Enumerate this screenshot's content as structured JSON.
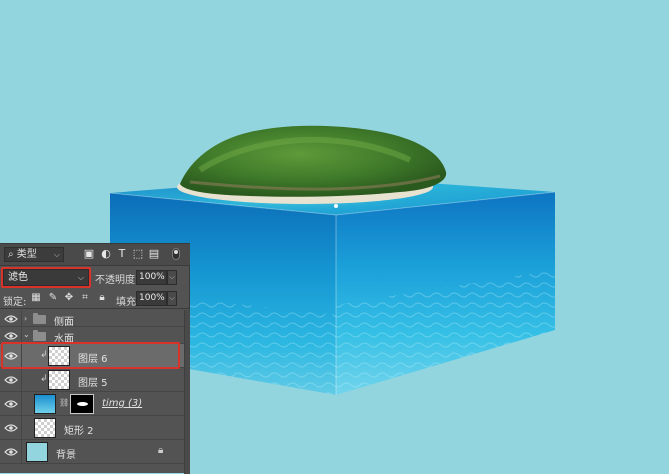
{
  "layers_panel": {
    "filter": {
      "kind_label": "类型"
    },
    "blend_mode": "滤色",
    "opacity_label": "不透明度:",
    "opacity_value": "100%",
    "lock_label": "锁定:",
    "fill_label": "填充:",
    "fill_value": "100%",
    "layers": [
      {
        "name": "侧面",
        "type": "group",
        "collapsed": true,
        "visible": true
      },
      {
        "name": "水面",
        "type": "group",
        "collapsed": false,
        "visible": true
      },
      {
        "name": "图层 6",
        "type": "layer",
        "clipped": true,
        "visible": true,
        "selected": true
      },
      {
        "name": "图层 5",
        "type": "layer",
        "clipped": true,
        "visible": true
      },
      {
        "name": "timg (3)",
        "type": "masked-layer",
        "visible": true
      },
      {
        "name": "矩形 2",
        "type": "shape",
        "visible": true
      },
      {
        "name": "背景",
        "type": "background",
        "visible": true,
        "locked": true
      }
    ]
  },
  "colors": {
    "canvas_background": "#93d5df",
    "panel_background": "#535353",
    "selected_row": "#6b6b6b",
    "highlight_box": "#d9322b",
    "water_top": "#1a9ed8",
    "water_bottom": "#6fd3ec"
  }
}
